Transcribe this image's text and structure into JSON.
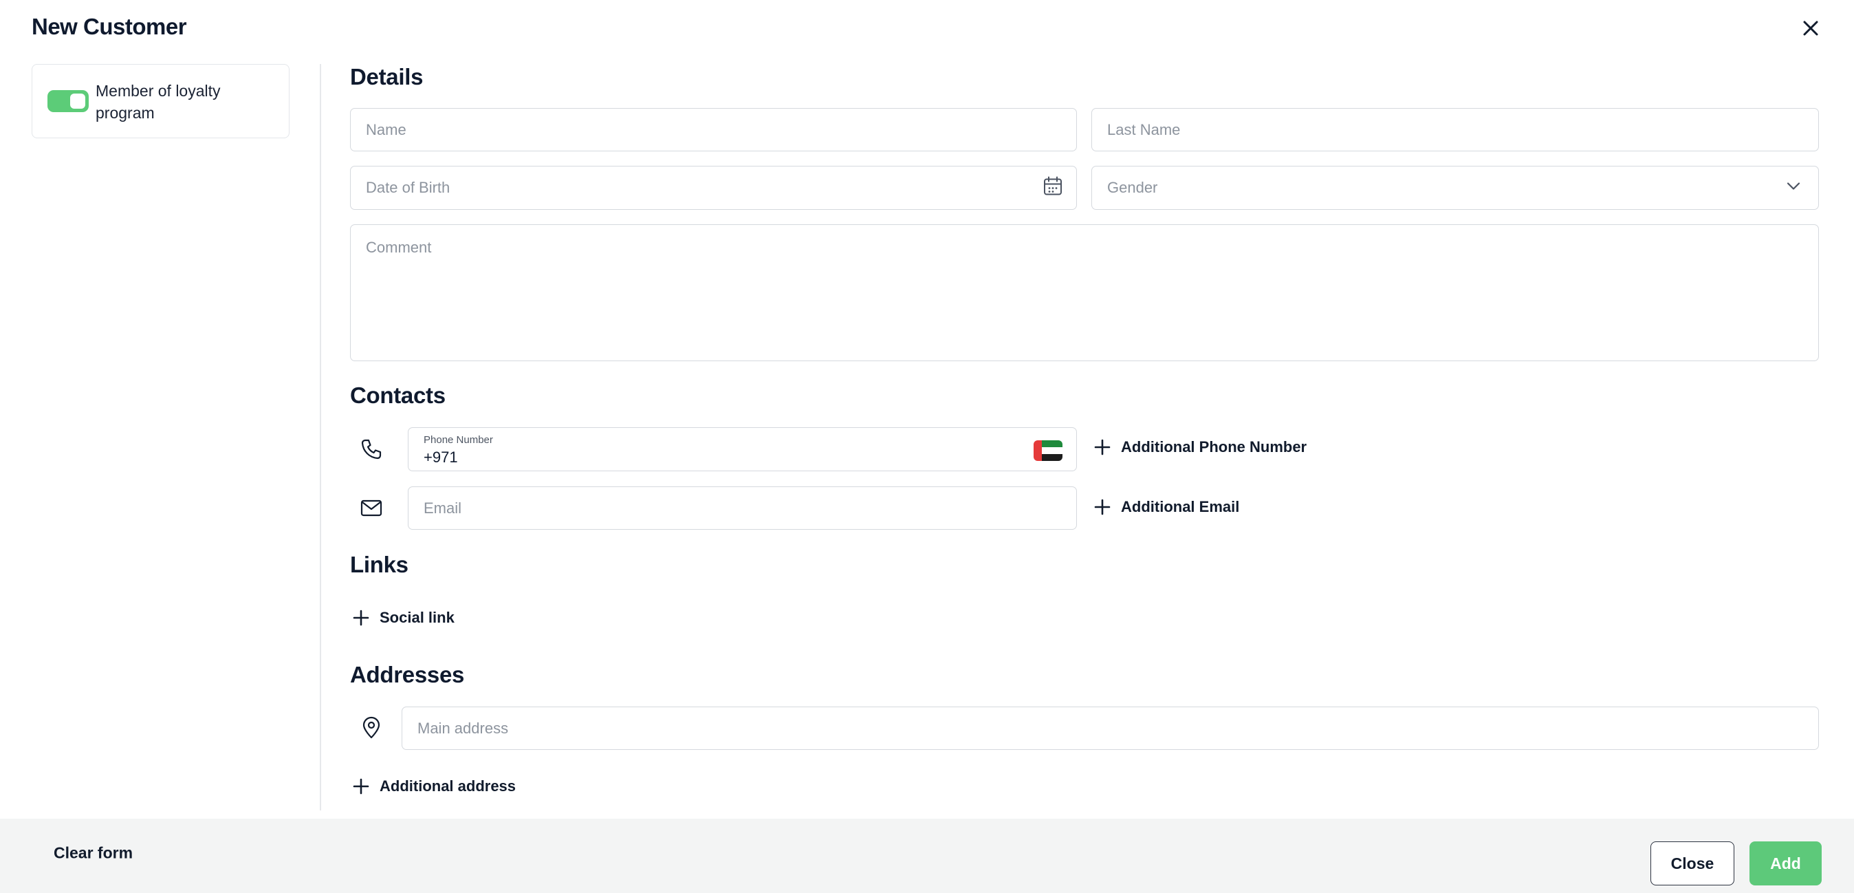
{
  "header": {
    "title": "New Customer"
  },
  "loyalty": {
    "label": "Member of loyalty program",
    "enabled": true
  },
  "details": {
    "title": "Details",
    "name_placeholder": "Name",
    "last_name_placeholder": "Last Name",
    "dob_placeholder": "Date of Birth",
    "gender_placeholder": "Gender",
    "comment_placeholder": "Comment"
  },
  "contacts": {
    "title": "Contacts",
    "phone_label": "Phone Number",
    "phone_value": "+971",
    "add_phone": "Additional Phone Number",
    "email_placeholder": "Email",
    "add_email": "Additional Email"
  },
  "links": {
    "title": "Links",
    "add_social": "Social link"
  },
  "addresses": {
    "title": "Addresses",
    "main_placeholder": "Main address",
    "add_address": "Additional address"
  },
  "footer": {
    "clear": "Clear form",
    "close": "Close",
    "add": "Add"
  },
  "colors": {
    "accent": "#5dc97a",
    "text": "#0f1a2e",
    "border": "#d5d9de",
    "footer_bg": "#f3f4f4"
  }
}
